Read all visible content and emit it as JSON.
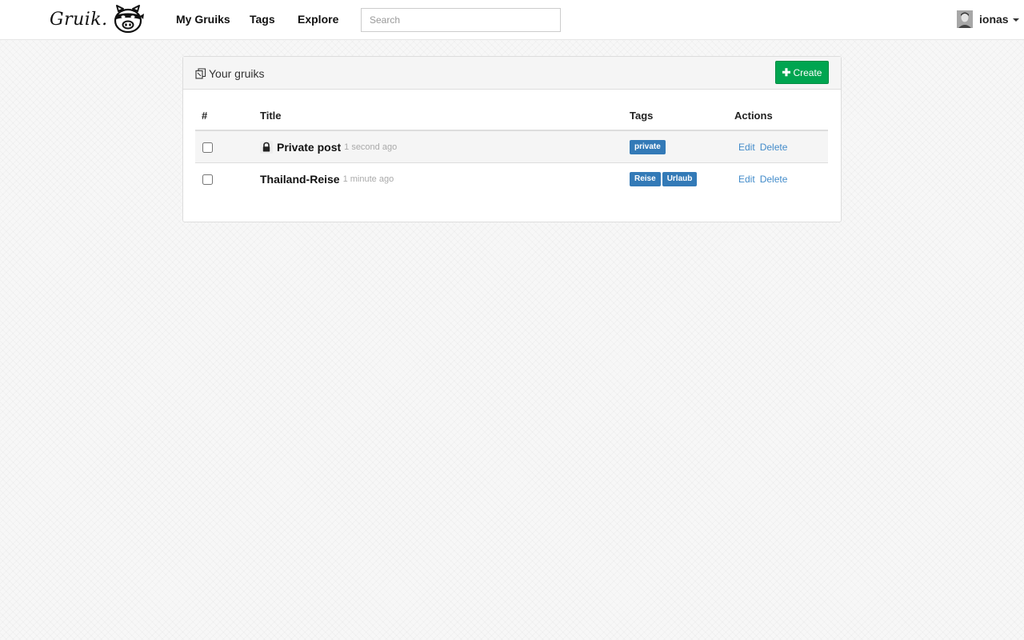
{
  "brand": {
    "name": "Gruik."
  },
  "nav": {
    "links": [
      {
        "label": "My Gruiks"
      },
      {
        "label": "Tags"
      },
      {
        "label": "Explore"
      }
    ]
  },
  "search": {
    "placeholder": "Search",
    "value": ""
  },
  "user": {
    "name": "ionas"
  },
  "panel": {
    "title": "Your gruiks",
    "create_label": "Create"
  },
  "table": {
    "headers": {
      "num": "#",
      "title": "Title",
      "tags": "Tags",
      "actions": "Actions"
    },
    "rows": [
      {
        "title": "Private post",
        "time": "1 second ago",
        "private": true,
        "tags": [
          "private"
        ],
        "edit_label": "Edit",
        "delete_label": "Delete"
      },
      {
        "title": "Thailand-Reise",
        "time": "1 minute ago",
        "private": false,
        "tags": [
          "Reise",
          "Urlaub"
        ],
        "edit_label": "Edit",
        "delete_label": "Delete"
      }
    ]
  },
  "colors": {
    "create_button": "#00a550",
    "tag": "#337ab7",
    "link": "#428bca",
    "muted": "#aaaaaa"
  },
  "icons": [
    "pig-logo-icon",
    "avatar",
    "copy-icon",
    "plus-icon",
    "lock-icon",
    "caret-down-icon"
  ]
}
